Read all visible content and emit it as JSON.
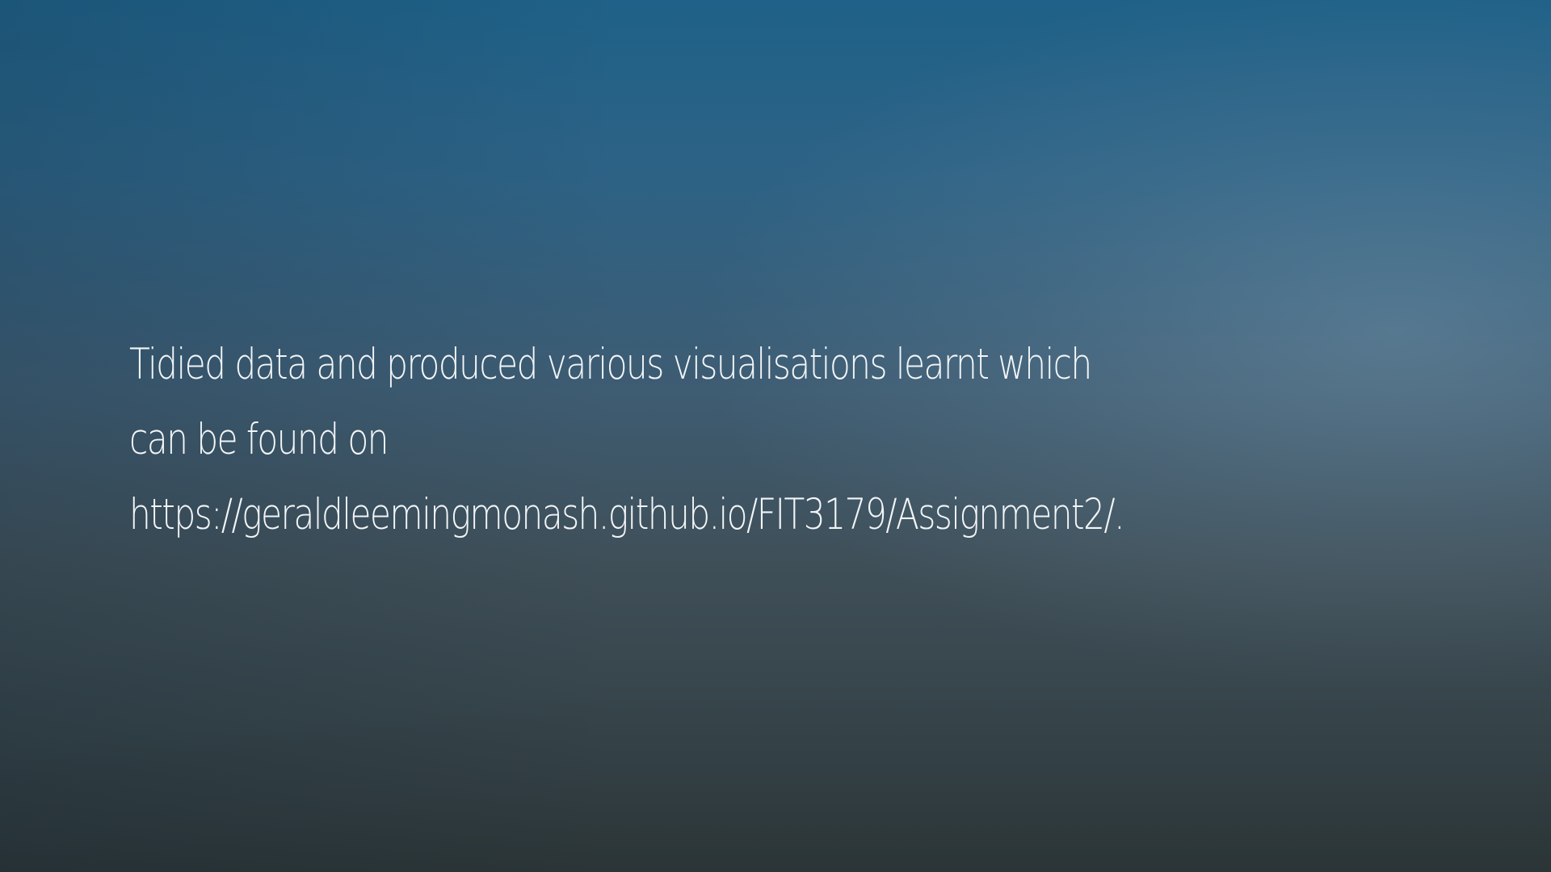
{
  "slide": {
    "text_lines": [
      "Tidied data and produced various visualisations learnt which",
      "can be found on",
      "https://geraldleemingmonash.github.io/FIT3179/Assignment2/."
    ]
  },
  "colors": {
    "background_top": "#1f6188",
    "background_bottom": "#2b3537",
    "text": "#f2f5f7"
  }
}
